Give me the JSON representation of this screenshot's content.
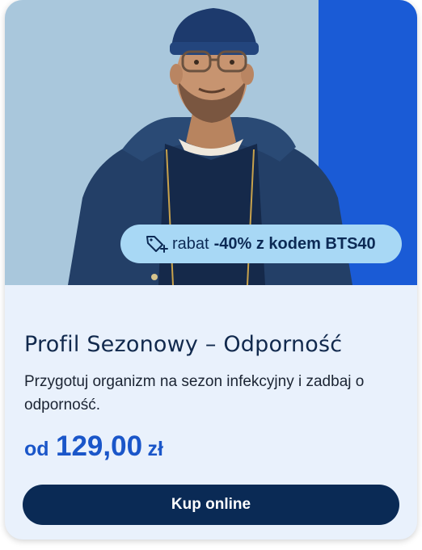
{
  "card": {
    "promo": {
      "icon": "tag-plus-icon",
      "prefix": "rabat",
      "code_text": "-40% z kodem BTS40"
    },
    "title": "Profil Sezonowy – Odporność",
    "description": "Przygotuj organizm na sezon infekcyjny i zadbaj o odporność.",
    "price": {
      "prefix": "od",
      "amount": "129,00",
      "currency": "zł"
    },
    "button_label": "Kup online"
  },
  "colors": {
    "hero_background": "#a9c7dc",
    "hero_accent_stripe": "#1a5bd6",
    "card_background": "#e9f1fc",
    "promo_badge": "#a8d8f5",
    "price": "#1a56c9",
    "button": "#0a2a55"
  }
}
